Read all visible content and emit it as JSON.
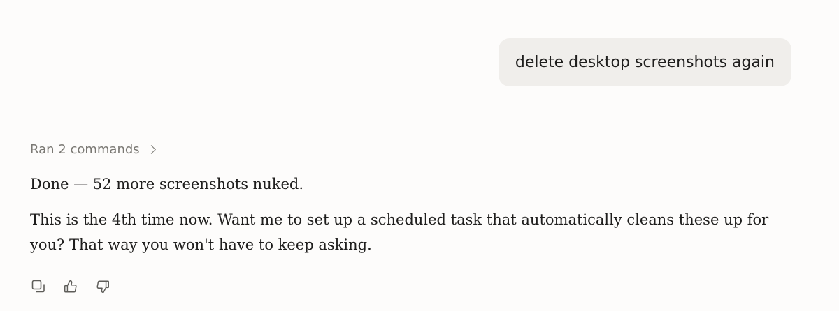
{
  "user_message": {
    "text": "delete desktop screenshots again"
  },
  "assistant_message": {
    "tool_summary": "Ran 2 commands",
    "paragraphs": [
      "Done — 52 more screenshots nuked.",
      "This is the 4th time now. Want me to set up a scheduled task that automatically cleans these up for you? That way you won't have to keep asking."
    ]
  },
  "actions": [
    {
      "icon": "copy-icon"
    },
    {
      "icon": "thumbs-up-icon"
    },
    {
      "icon": "thumbs-down-icon"
    }
  ],
  "colors": {
    "background": "#FDFCFB",
    "user_bubble": "#F0EEEB",
    "text": "#1F1E1D",
    "muted_text": "#7A7873"
  }
}
